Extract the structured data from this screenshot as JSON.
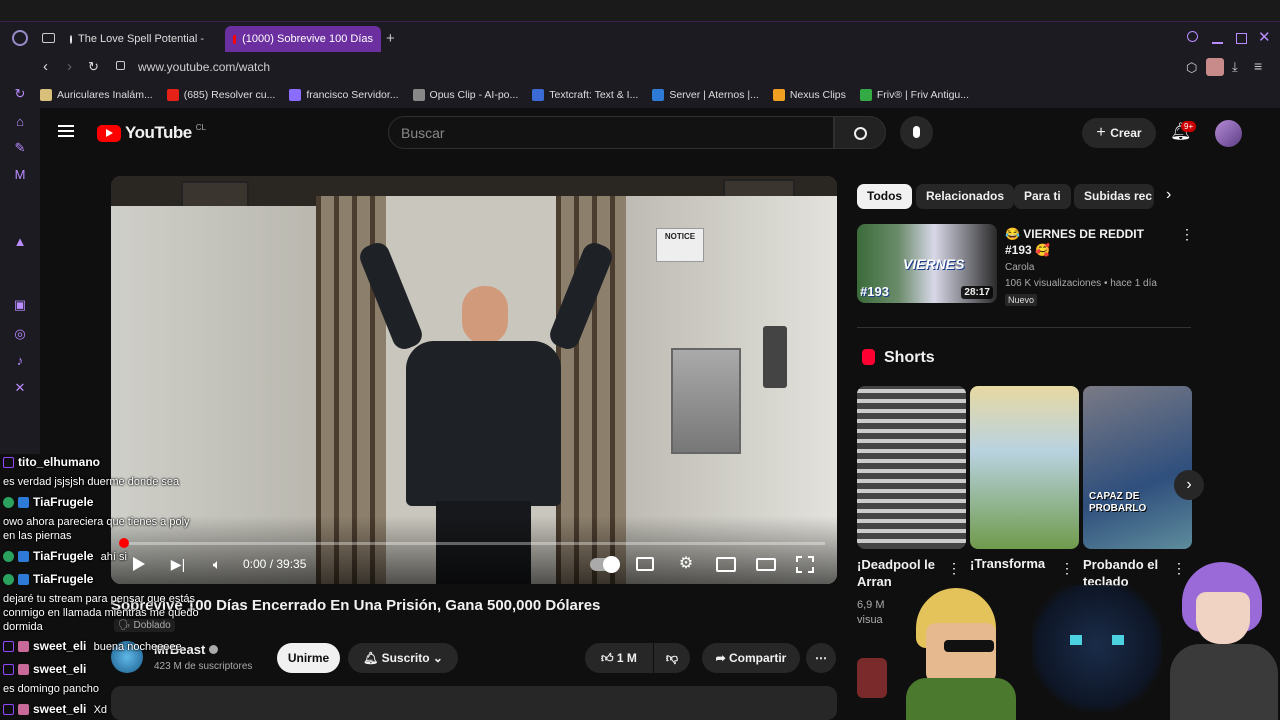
{
  "browser": {
    "tabs": [
      {
        "label": "The Love Spell Potential -"
      },
      {
        "label": "(1000) Sobrevive 100 Días"
      }
    ],
    "new_tab": "+",
    "url": "www.youtube.com/watch",
    "bookmarks": [
      {
        "label": "Auriculares Inalám...",
        "color": "#d9c07a"
      },
      {
        "label": "(685) Resolver cu...",
        "color": "#e62117"
      },
      {
        "label": "francisco Servidor...",
        "color": "#8a6cff"
      },
      {
        "label": "Opus Clip - AI-po...",
        "color": "#888888"
      },
      {
        "label": "Textcraft: Text & I...",
        "color": "#3b6bd4"
      },
      {
        "label": "Server | Aternos |...",
        "color": "#2e7bd6"
      },
      {
        "label": "Nexus Clips",
        "color": "#f0a020"
      },
      {
        "label": "Friv® | Friv Antigu...",
        "color": "#33aa44"
      }
    ]
  },
  "youtube": {
    "logo": "YouTube",
    "region": "CL",
    "search_placeholder": "Buscar",
    "create_label": "Crear",
    "notifications": "9+",
    "chips": [
      "Todos",
      "Relacionados",
      "Para ti",
      "Subidas rec"
    ],
    "player": {
      "time": "0:00 / 39:35",
      "notice_sign": "NOTICE"
    },
    "video": {
      "title": "Sobrevive 100 Días Encerrado En Una Prisión, Gana 500,000 Dólares",
      "dubbed": "Doblado",
      "channel": "MrBeast",
      "subscribers": "423 M de suscriptores",
      "join": "Unirme",
      "subscribed": "Suscrito",
      "likes": "1 M",
      "share": "Compartir"
    },
    "recommended": {
      "title": "😂 VIERNES DE REDDIT #193 🥰",
      "channel": "Carola",
      "meta": "106 K visualizaciones • hace 1 día",
      "badge": "Nuevo",
      "duration": "28:17",
      "thumb_text": "VIERNES",
      "thumb_number": "#193"
    },
    "shorts_heading": "Shorts",
    "shorts": [
      {
        "title": "¡Deadpool le Arran",
        "meta": "6,9 M visua"
      },
      {
        "title": "¡Transforma",
        "meta": ""
      },
      {
        "title": "Probando el teclado",
        "meta": "",
        "overlay": "CAPAZ DE PROBARLO"
      }
    ]
  },
  "chat": [
    {
      "user": "tito_elhumano",
      "msg": "es verdad jsjsjsh duerme donde sea"
    },
    {
      "user": "TiaFrugele",
      "msg": "owo ahora pareciera que tienes a poly en las piernas"
    },
    {
      "user": "TiaFrugele",
      "msg": "ahí si"
    },
    {
      "user": "TiaFrugele",
      "msg": "dejaré tu stream para pensar que estás conmigo en llamada mientras me quedo dormida"
    },
    {
      "user": "sweet_eli",
      "msg": "buena nocheeeee"
    },
    {
      "user": "sweet_eli",
      "msg": "es domingo pancho"
    },
    {
      "user": "sweet_eli",
      "msg": "Xd"
    }
  ],
  "colors": {
    "accent": "#6c2fa0",
    "yt_red": "#ff0000",
    "twitch": "#9146ff"
  }
}
